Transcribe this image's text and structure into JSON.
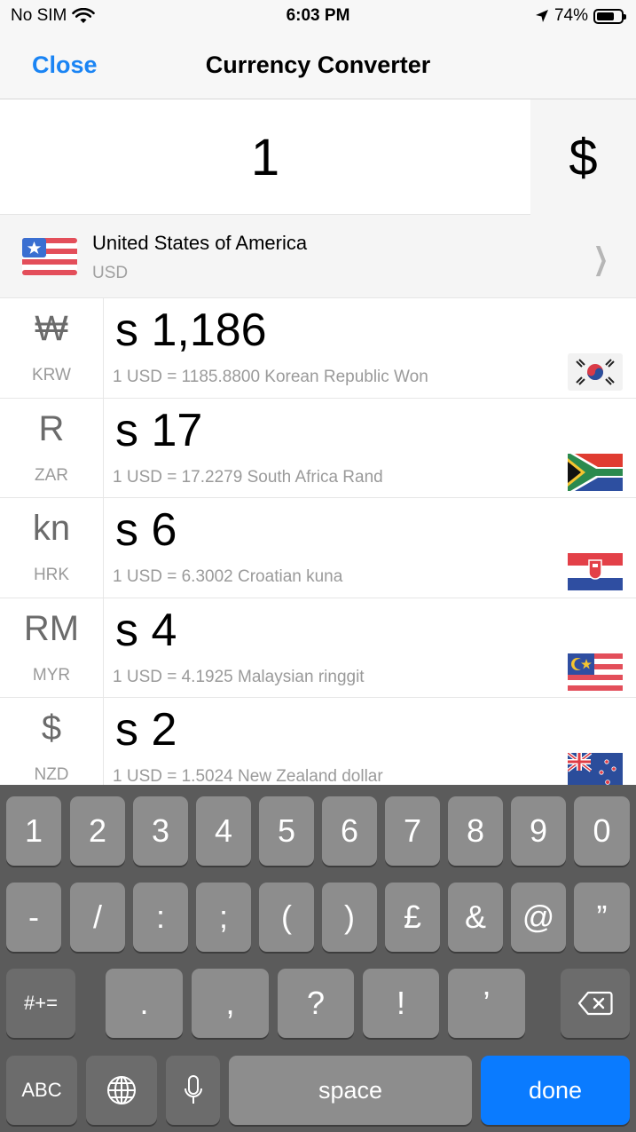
{
  "status_bar": {
    "carrier": "No SIM",
    "time": "6:03 PM",
    "battery": "74%",
    "battery_level": 0.74,
    "icons": [
      "wifi-icon",
      "location-arrow-icon",
      "battery-icon"
    ]
  },
  "nav": {
    "close_label": "Close",
    "title": "Currency Converter"
  },
  "input": {
    "amount": "1",
    "symbol": "$"
  },
  "base_currency": {
    "name": "United States of America",
    "code": "USD",
    "flag": "usa-flag-icon"
  },
  "currencies": [
    {
      "symbol": "₩",
      "code": "KRW",
      "amount": "s 1,186",
      "rate": "1 USD = 1185.8800 Korean Republic Won",
      "flag": "south-korea-flag-icon"
    },
    {
      "symbol": "R",
      "code": "ZAR",
      "amount": "s 17",
      "rate": "1 USD = 17.2279 South Africa Rand",
      "flag": "south-africa-flag-icon"
    },
    {
      "symbol": "kn",
      "code": "HRK",
      "amount": "s 6",
      "rate": "1 USD = 6.3002 Croatian kuna",
      "flag": "croatia-flag-icon"
    },
    {
      "symbol": "RM",
      "code": "MYR",
      "amount": "s 4",
      "rate": "1 USD = 4.1925 Malaysian ringgit",
      "flag": "malaysia-flag-icon"
    },
    {
      "symbol": "$",
      "code": "NZD",
      "amount": "s 2",
      "rate": "1 USD = 1.5024 New Zealand dollar",
      "flag": "new-zealand-flag-icon"
    }
  ],
  "keyboard": {
    "row1": [
      "1",
      "2",
      "3",
      "4",
      "5",
      "6",
      "7",
      "8",
      "9",
      "0"
    ],
    "row2": [
      "-",
      "/",
      ":",
      ";",
      "(",
      ")",
      "£",
      "&",
      "@",
      "”"
    ],
    "row3_mode": "#+=",
    "row3": [
      ".",
      ",",
      "?",
      "!",
      "’"
    ],
    "abc": "ABC",
    "space": "space",
    "done": "done",
    "colors": {
      "key": "#8d8d8d",
      "background": "#5b5b5b",
      "done": "#0a7bff"
    }
  },
  "accent_color": "#1a84f4"
}
